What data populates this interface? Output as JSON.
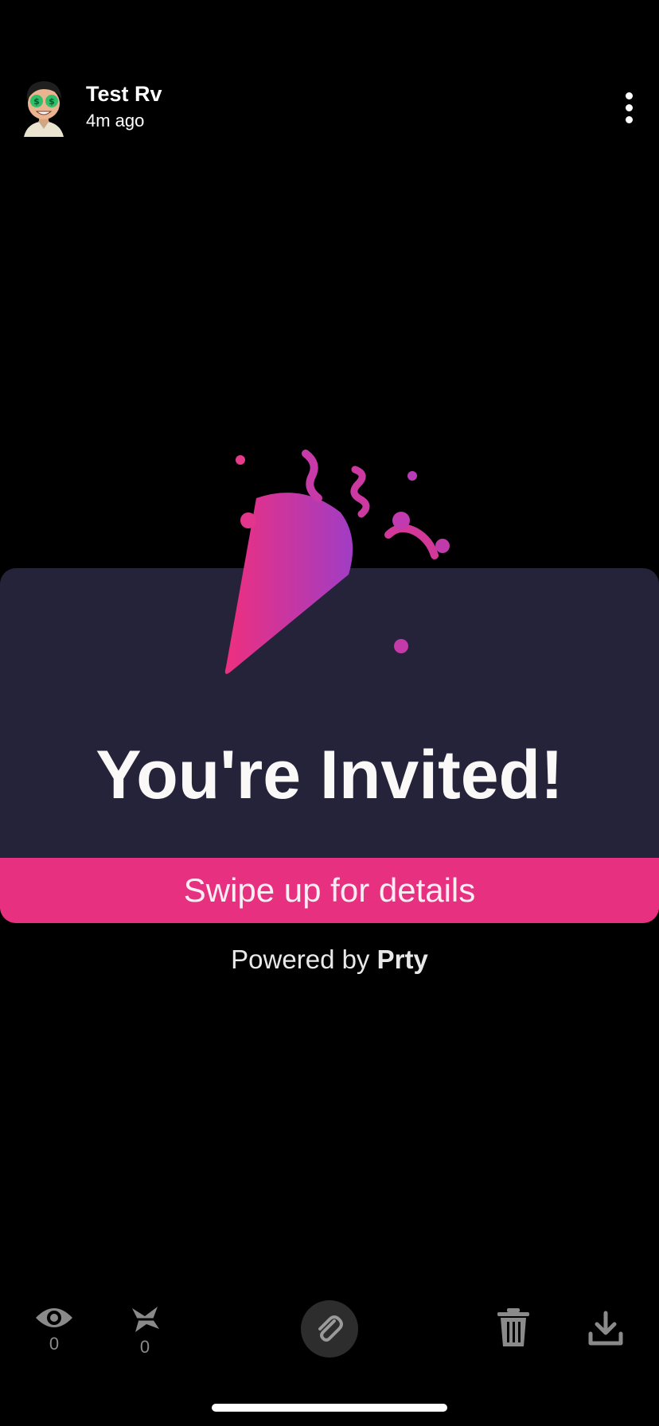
{
  "header": {
    "user_name": "Test Rv",
    "timestamp": "4m ago",
    "avatar_icon": "bitmoji-money-eyes-avatar",
    "more_icon": "more-vertical-icon"
  },
  "card": {
    "title": "You're Invited!",
    "swipe_text": "Swipe up for details",
    "icon": "party-popper-icon",
    "colors": {
      "card_bg": "#252339",
      "accent": "#e73180",
      "popper_gradient_start": "#ee2f7f",
      "popper_gradient_end": "#a13dc4"
    }
  },
  "powered_by": {
    "prefix": "Powered by ",
    "brand": "Prty"
  },
  "toolbar": {
    "views_count": "0",
    "screenshots_count": "0",
    "icons": [
      "eye-icon",
      "screenshot-icon",
      "paperclip-icon",
      "trash-icon",
      "download-icon"
    ]
  }
}
